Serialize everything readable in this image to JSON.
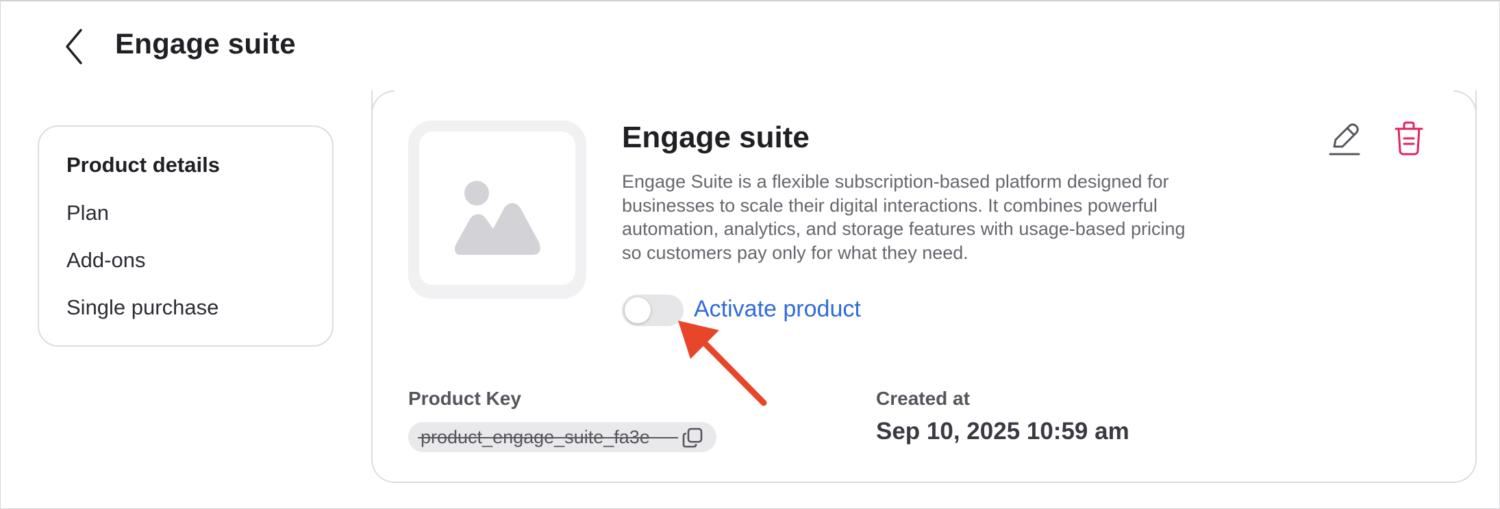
{
  "header": {
    "title": "Engage suite",
    "back_icon": "chevron-left-icon"
  },
  "sidebar": {
    "items": [
      {
        "label": "Product details",
        "active": true
      },
      {
        "label": "Plan",
        "active": false
      },
      {
        "label": "Add-ons",
        "active": false
      },
      {
        "label": "Single purchase",
        "active": false
      }
    ]
  },
  "product": {
    "name": "Engage suite",
    "description": "Engage Suite is a flexible subscription-based platform designed for businesses to scale their digital interactions. It combines powerful automation, analytics, and storage features with usage-based pricing so customers pay only for what they need.",
    "image_icon": "image-placeholder-icon",
    "edit_icon": "pencil-icon",
    "delete_icon": "trash-icon",
    "activate_label": "Activate product",
    "active": false,
    "key_label": "Product Key",
    "key_value": "product_engage_suite_fa3e",
    "copy_icon": "copy-icon",
    "created_label": "Created at",
    "created_value": "Sep 10, 2025 10:59 am"
  },
  "colors": {
    "accent": "#2f6bd9",
    "danger": "#e0245e",
    "annotation_arrow": "#e8462b"
  }
}
